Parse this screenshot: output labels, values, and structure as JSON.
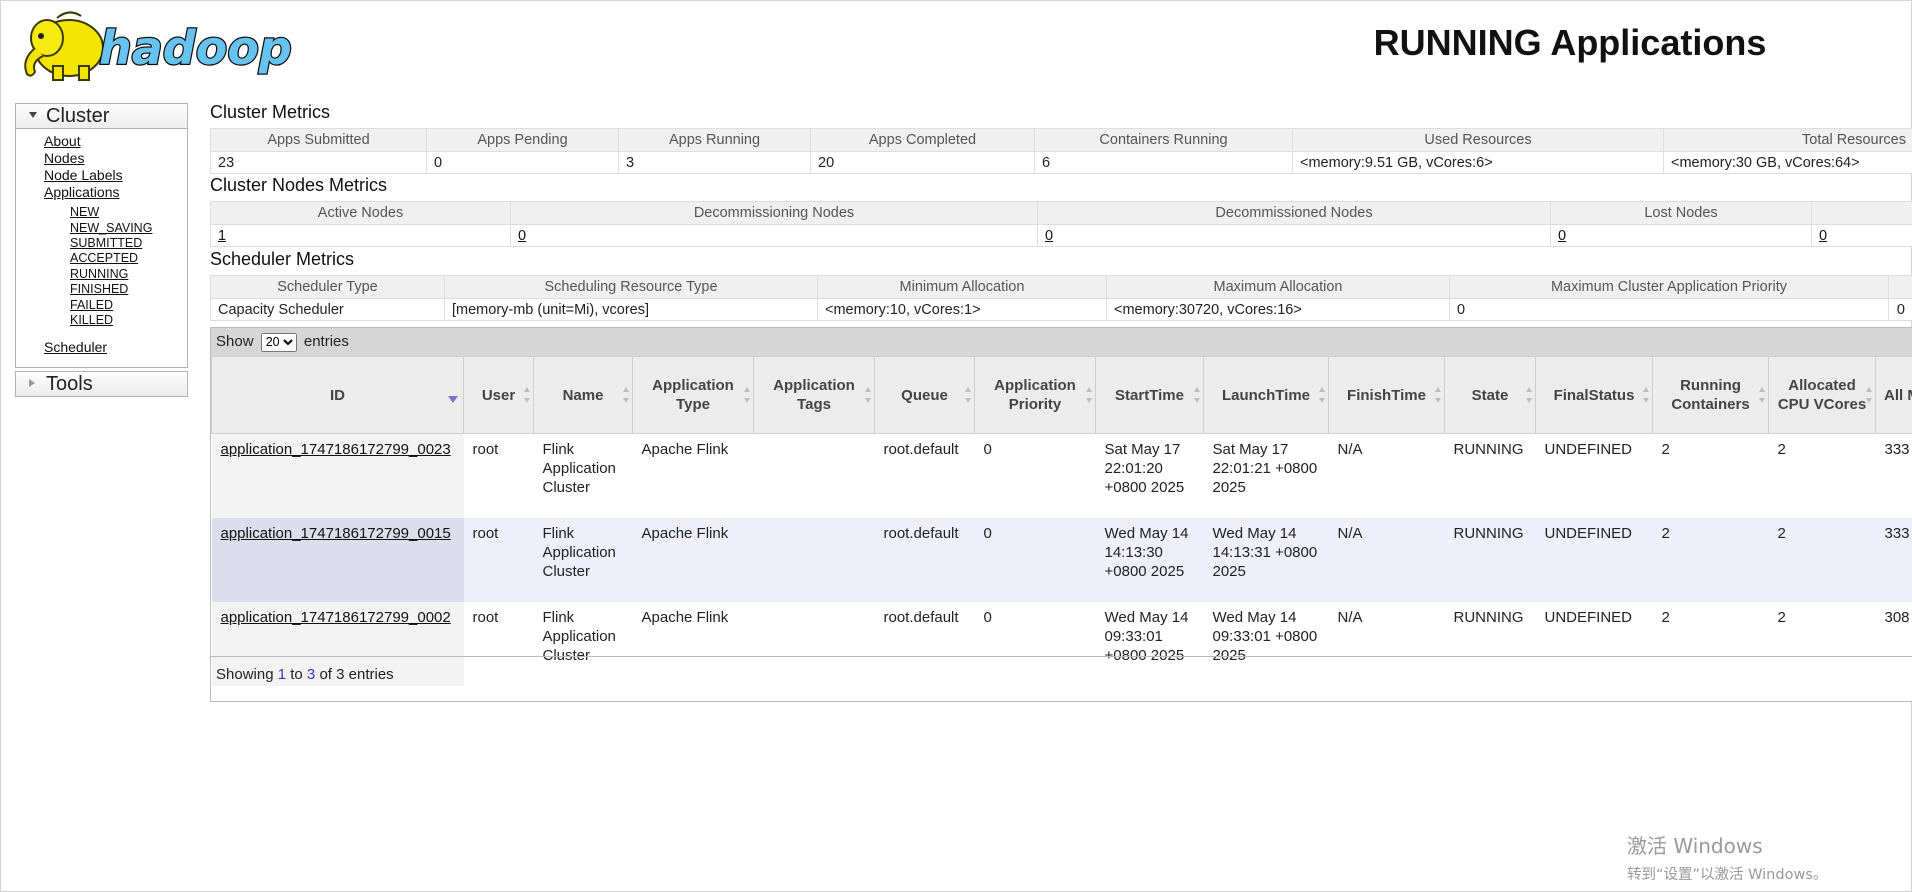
{
  "header": {
    "brand": "hadoop",
    "title": "RUNNING Applications"
  },
  "sidebar": {
    "cluster_label": "Cluster",
    "tools_label": "Tools",
    "links": [
      "About",
      "Nodes",
      "Node Labels",
      "Applications"
    ],
    "app_states": [
      "NEW",
      "NEW_SAVING",
      "SUBMITTED",
      "ACCEPTED",
      "RUNNING",
      "FINISHED",
      "FAILED",
      "KILLED"
    ],
    "scheduler": "Scheduler"
  },
  "cluster_metrics": {
    "title": "Cluster Metrics",
    "headers": [
      "Apps Submitted",
      "Apps Pending",
      "Apps Running",
      "Apps Completed",
      "Containers Running",
      "Used Resources",
      "Total Resources"
    ],
    "values": [
      "23",
      "0",
      "3",
      "20",
      "6",
      "<memory:9.51 GB, vCores:6>",
      "<memory:30 GB, vCores:64>"
    ]
  },
  "node_metrics": {
    "title": "Cluster Nodes Metrics",
    "headers": [
      "Active Nodes",
      "Decommissioning Nodes",
      "Decommissioned Nodes",
      "Lost Nodes"
    ],
    "values": [
      "1",
      "0",
      "0",
      "0",
      "0"
    ]
  },
  "scheduler_metrics": {
    "title": "Scheduler Metrics",
    "headers": [
      "Scheduler Type",
      "Scheduling Resource Type",
      "Minimum Allocation",
      "Maximum Allocation",
      "Maximum Cluster Application Priority"
    ],
    "values": [
      "Capacity Scheduler",
      "[memory-mb (unit=Mi), vcores]",
      "<memory:10, vCores:1>",
      "<memory:30720, vCores:16>",
      "0",
      "0"
    ]
  },
  "apps": {
    "show_label": "Show",
    "entries_label": "entries",
    "page_size": "20",
    "columns": [
      "ID",
      "User",
      "Name",
      "Application Type",
      "Application Tags",
      "Queue",
      "Application Priority",
      "StartTime",
      "LaunchTime",
      "FinishTime",
      "State",
      "FinalStatus",
      "Running Containers",
      "Allocated CPU VCores",
      "All M"
    ],
    "rows": [
      {
        "id": "application_1747186172799_0023",
        "user": "root",
        "name": "Flink Application Cluster",
        "type": "Apache Flink",
        "tags": "",
        "queue": "root.default",
        "priority": "0",
        "start": "Sat May 17 22:01:20 +0800 2025",
        "launch": "Sat May 17 22:01:21 +0800 2025",
        "finish": "N/A",
        "state": "RUNNING",
        "final": "UNDEFINED",
        "containers": "2",
        "vcores": "2",
        "mem": "333"
      },
      {
        "id": "application_1747186172799_0015",
        "user": "root",
        "name": "Flink Application Cluster",
        "type": "Apache Flink",
        "tags": "",
        "queue": "root.default",
        "priority": "0",
        "start": "Wed May 14 14:13:30 +0800 2025",
        "launch": "Wed May 14 14:13:31 +0800 2025",
        "finish": "N/A",
        "state": "RUNNING",
        "final": "UNDEFINED",
        "containers": "2",
        "vcores": "2",
        "mem": "333"
      },
      {
        "id": "application_1747186172799_0002",
        "user": "root",
        "name": "Flink Application Cluster",
        "type": "Apache Flink",
        "tags": "",
        "queue": "root.default",
        "priority": "0",
        "start": "Wed May 14 09:33:01 +0800 2025",
        "launch": "Wed May 14 09:33:01 +0800 2025",
        "finish": "N/A",
        "state": "RUNNING",
        "final": "UNDEFINED",
        "containers": "2",
        "vcores": "2",
        "mem": "308"
      }
    ],
    "info_prefix": "Showing",
    "info_from": "1",
    "info_to_word": "to",
    "info_to": "3",
    "info_of_word": "of",
    "info_total": "3",
    "info_suffix": "entries"
  },
  "watermark": {
    "line1": "激活 Windows",
    "line2": "转到“设置”以激活 Windows。"
  },
  "colors": {
    "sort_active": "#7a72c4",
    "row_even": "#efeffa",
    "toolbar": "#d6d6d6"
  }
}
